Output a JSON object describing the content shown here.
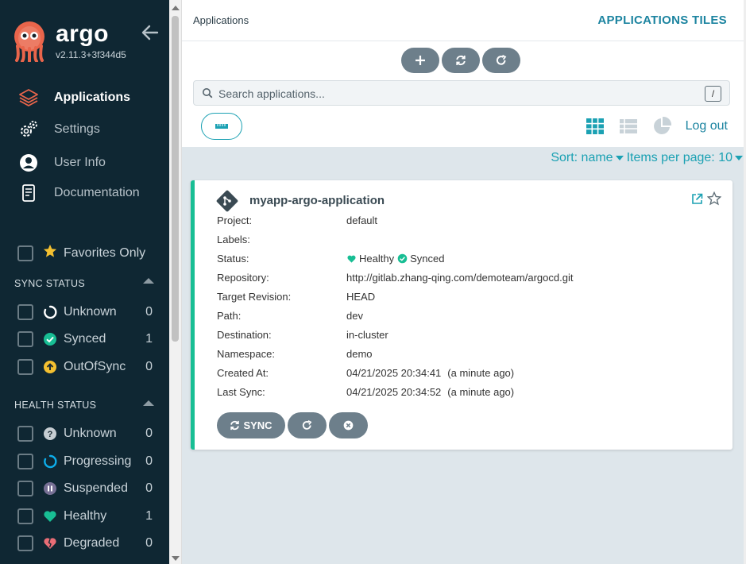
{
  "app": {
    "logo_text": "argo",
    "version": "v2.11.3+3f344d5"
  },
  "nav": [
    {
      "label": "Applications",
      "active": true,
      "icon": "layers-icon"
    },
    {
      "label": "Settings",
      "active": false,
      "icon": "gears-icon"
    },
    {
      "label": "User Info",
      "active": false,
      "icon": "user-circle-icon"
    },
    {
      "label": "Documentation",
      "active": false,
      "icon": "book-icon"
    }
  ],
  "favorites_label": "Favorites Only",
  "sync_status": {
    "title": "SYNC STATUS",
    "items": [
      {
        "label": "Unknown",
        "count": "0",
        "icon": "circle-notch-icon"
      },
      {
        "label": "Synced",
        "count": "1",
        "icon": "check-circle-icon"
      },
      {
        "label": "OutOfSync",
        "count": "0",
        "icon": "arrow-up-circle-icon"
      }
    ]
  },
  "health_status": {
    "title": "HEALTH STATUS",
    "items": [
      {
        "label": "Unknown",
        "count": "0",
        "icon": "question-circle-icon"
      },
      {
        "label": "Progressing",
        "count": "0",
        "icon": "circle-notch-icon"
      },
      {
        "label": "Suspended",
        "count": "0",
        "icon": "pause-circle-icon"
      },
      {
        "label": "Healthy",
        "count": "1",
        "icon": "heart-icon"
      },
      {
        "label": "Degraded",
        "count": "0",
        "icon": "heart-broken-icon"
      }
    ]
  },
  "header": {
    "breadcrumb": "Applications",
    "view_title": "APPLICATIONS TILES",
    "logout": "Log out"
  },
  "search": {
    "placeholder": "Search applications...",
    "value": "",
    "shortcut": "/"
  },
  "sort": {
    "label": "Sort: name",
    "per_page": "Items per page: 10"
  },
  "app_card": {
    "name": "myapp-argo-application",
    "fields": [
      {
        "key": "Project:",
        "value": "default"
      },
      {
        "key": "Labels:",
        "value": ""
      },
      {
        "key": "Status:",
        "health": "Healthy",
        "sync": "Synced"
      },
      {
        "key": "Repository:",
        "value": "http://gitlab.zhang-qing.com/demoteam/argocd.git"
      },
      {
        "key": "Target Revision:",
        "value": "HEAD"
      },
      {
        "key": "Path:",
        "value": "dev"
      },
      {
        "key": "Destination:",
        "value": "in-cluster"
      },
      {
        "key": "Namespace:",
        "value": "demo"
      },
      {
        "key": "Created At:",
        "value": "04/21/2025 20:34:41",
        "ago": "(a minute ago)"
      },
      {
        "key": "Last Sync:",
        "value": "04/21/2025 20:34:52",
        "ago": "(a minute ago)"
      }
    ],
    "sync_button": "SYNC"
  },
  "colors": {
    "sidebar_bg": "#0f2733",
    "accent": "#1ba1b3",
    "healthy": "#18be94",
    "degraded": "#e96d76",
    "progressing": "#0dadea",
    "outofsync": "#f4c030",
    "button_gray": "#6d7f8b"
  }
}
